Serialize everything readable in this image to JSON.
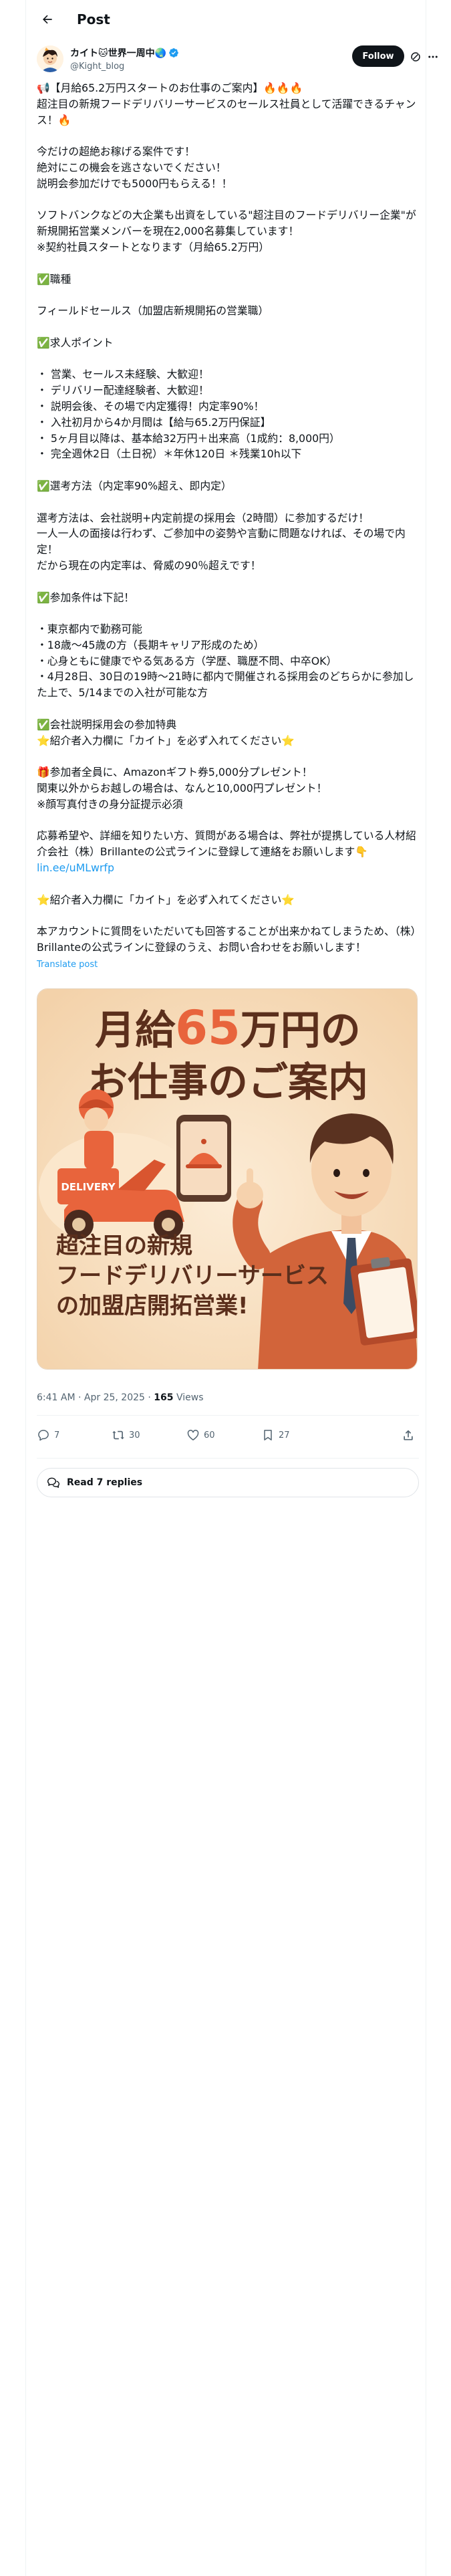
{
  "header": {
    "title": "Post"
  },
  "author": {
    "display_name": "カイト🐱世界一周中🌏",
    "handle": "@Kight_blog",
    "follow_label": "Follow"
  },
  "post": {
    "body": "📢【月給65.2万円スタートのお仕事のご案内】🔥🔥🔥\n超注目の新規フードデリバリーサービスのセールス社員として活躍できるチャンス！🔥\n\n今だけの超絶お稼げる案件です！\n絶対にこの機会を逃さないでください！\n説明会参加だけでも5000円もらえる！！\n\nソフトバンクなどの大企業も出資をしている\"超注目のフードデリバリー企業\"が新規開拓営業メンバーを現在2,000名募集しています！\n※契約社員スタートとなります（月給65.2万円）\n\n✅職種\n\nフィールドセールス（加盟店新規開拓の営業職）\n\n✅求人ポイント\n\n・ 営業、セールス未経験、大歓迎！\n・ デリバリー配達経験者、大歓迎！\n・ 説明会後、その場で内定獲得！内定率90%！\n・ 入社初月から4か月間は【給与65.2万円保証】\n・ 5ヶ月目以降は、基本給32万円＋出来高（1成約：8,000円）\n・ 完全週休2日（土日祝）＊年休120日 ＊残業10h以下\n\n✅選考方法（内定率90%超え、即内定）\n\n選考方法は、会社説明+内定前提の採用会（2時間）に参加するだけ！\n一人一人の面接は行わず、ご参加中の姿勢や言動に問題なければ、その場で内定！\nだから現在の内定率は、脅威の90％超えです！\n\n✅参加条件は下記！\n\n・東京都内で勤務可能\n・18歳〜45歳の方（長期キャリア形成のため）\n・心身ともに健康でやる気ある方（学歴、職歴不問、中卒OK）\n・4月28日、30日の19時〜21時に都内で開催される採用会のどちらかに参加した上で、5/14までの入社が可能な方\n\n✅会社説明採用会の参加特典\n⭐紹介者入力欄に「カイト」を必ず入れてください⭐\n\n🎁参加者全員に、Amazonギフト券5,000分プレゼント！\n関東以外からお越しの場合は、なんと10,000円プレゼント！\n※顔写真付きの身分証提示必須\n\n応募希望や、詳細を知りたい方、質問がある場合は、弊社が提携している人材紹介会社（株）Brillanteの公式ラインに登録して連絡をお願いします👇",
    "link": "lin.ee/uMLwrfp",
    "footer": "⭐紹介者入力欄に「カイト」を必ず入れてください⭐\n\n本アカウントに質問をいただいても回答することが出来かねてしまうため、（株）Brillanteの公式ラインに登録のうえ、お問い合わせをお願いします！",
    "translate_label": "Translate post"
  },
  "image": {
    "headline_line1_prefix": "月給",
    "headline_amount": "65",
    "headline_line1_suffix": "万円の",
    "headline_line2": "お仕事のご案内",
    "delivery_label": "DELIVERY",
    "caption_line1": "超注目の新規",
    "caption_line2": "フードデリバリーサービス",
    "caption_line3": "の加盟店開拓営業!",
    "colors": {
      "background": "#f9e2c4",
      "accent": "#e8643c",
      "text": "#5b2f1c"
    }
  },
  "meta": {
    "time": "6:41 AM",
    "separator": " · ",
    "date": "Apr 25, 2025",
    "views_count": "165",
    "views_label": " Views"
  },
  "actions": {
    "replies": "7",
    "reposts": "30",
    "likes": "60",
    "bookmarks": "27"
  },
  "read_replies_label": "Read 7 replies"
}
